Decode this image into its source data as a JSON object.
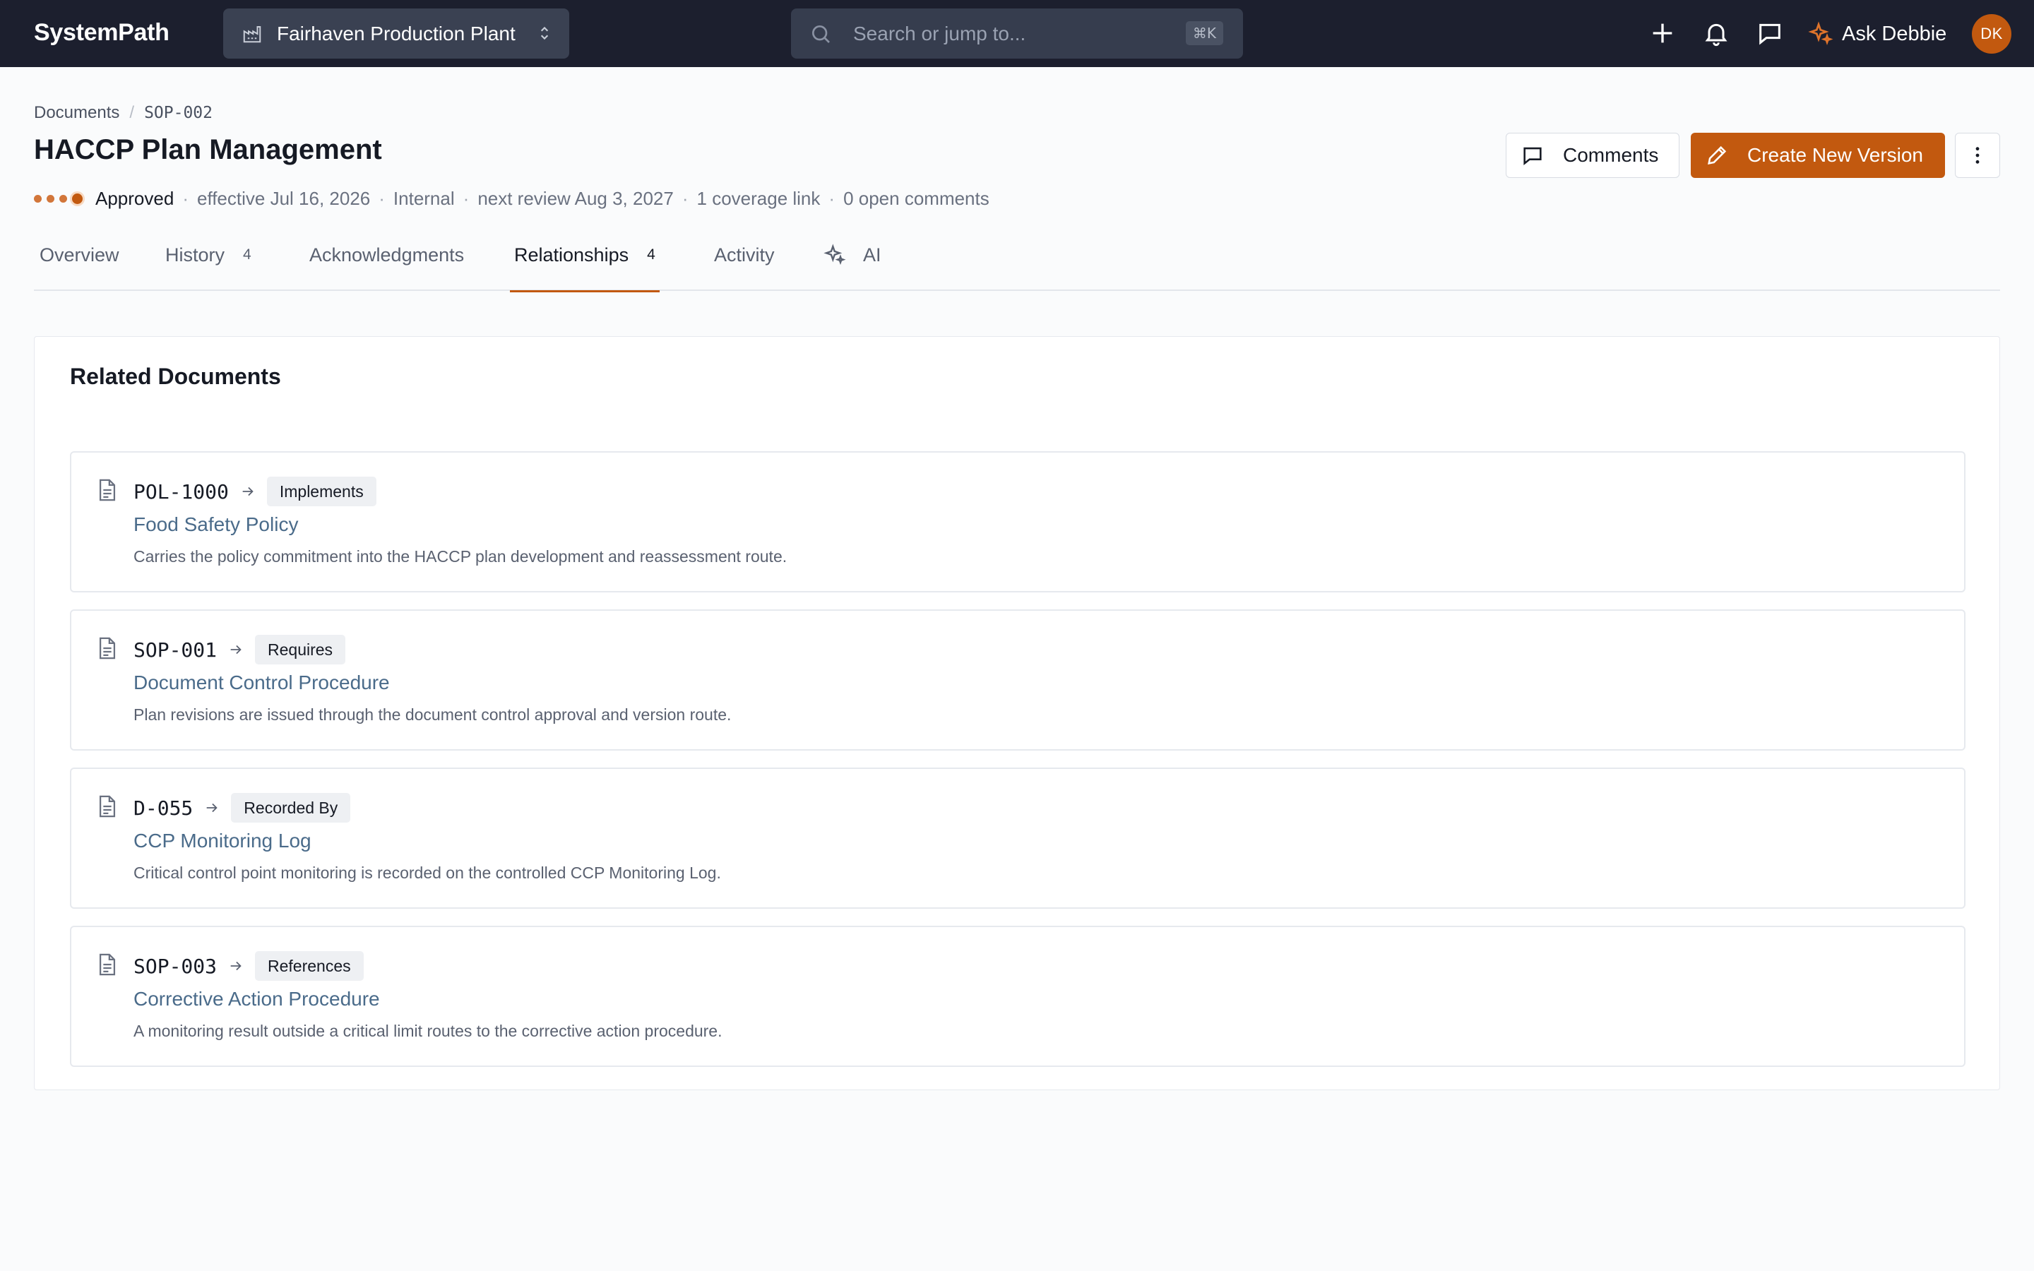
{
  "app": {
    "brand": "SystemPath",
    "site": "Fairhaven Production Plant",
    "search_placeholder": "Search or jump to...",
    "search_shortcut": "⌘K",
    "ask_label": "Ask Debbie",
    "avatar_initials": "DK"
  },
  "breadcrumb": {
    "root": "Documents",
    "current": "SOP-002"
  },
  "document": {
    "title": "HACCP Plan Management",
    "status": "Approved",
    "effective": "effective Jul 16, 2026",
    "classification": "Internal",
    "next_review": "next review Aug 3, 2027",
    "coverage": "1 coverage link",
    "open_comments": "0 open comments",
    "lifecycle_steps_completed": 4
  },
  "actions": {
    "comments_label": "Comments",
    "create_label": "Create New Version"
  },
  "tabs": [
    {
      "label": "Overview",
      "count": ""
    },
    {
      "label": "History",
      "count": "4"
    },
    {
      "label": "Acknowledgments",
      "count": ""
    },
    {
      "label": "Relationships",
      "count": "4"
    },
    {
      "label": "Activity",
      "count": ""
    },
    {
      "label": "AI",
      "count": ""
    }
  ],
  "active_tab": "Relationships",
  "related": {
    "heading": "Related Documents",
    "items": [
      {
        "code": "POL-1000",
        "relation": "Implements",
        "title": "Food Safety Policy",
        "description": "Carries the policy commitment into the HACCP plan development and reassessment route."
      },
      {
        "code": "SOP-001",
        "relation": "Requires",
        "title": "Document Control Procedure",
        "description": "Plan revisions are issued through the document control approval and version route."
      },
      {
        "code": "D-055",
        "relation": "Recorded By",
        "title": "CCP Monitoring Log",
        "description": "Critical control point monitoring is recorded on the controlled CCP Monitoring Log."
      },
      {
        "code": "SOP-003",
        "relation": "References",
        "title": "Corrective Action Procedure",
        "description": "A monitoring result outside a critical limit routes to the corrective action procedure."
      }
    ]
  },
  "colors": {
    "accent": "#c2590f",
    "topbar": "#1c1f2e",
    "link": "#4a6b8a"
  },
  "icons": {
    "site": "factory-icon",
    "search": "search-icon",
    "add": "plus-icon",
    "notifications": "bell-icon",
    "messages": "chat-icon",
    "ask": "sparkle-icon",
    "comments": "comment-icon",
    "create": "pencil-icon",
    "more": "more-vertical-icon",
    "document": "document-icon",
    "relation": "arrow-right-icon"
  }
}
